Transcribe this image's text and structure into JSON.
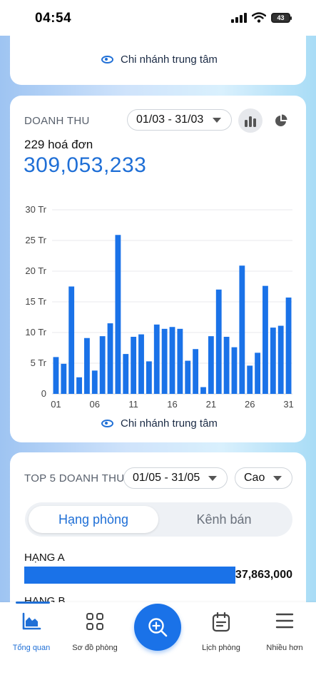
{
  "status_bar": {
    "time": "04:54",
    "battery": "43"
  },
  "branch_card": {
    "branch_label": "Chi nhánh trung tâm"
  },
  "revenue": {
    "title": "DOANH THU",
    "date_range": "01/03 - 31/03",
    "invoice_count": "229 hoá đơn",
    "total": "309,053,233",
    "branch_label": "Chi nhánh trung tâm"
  },
  "chart_data": {
    "type": "bar",
    "title": "",
    "xlabel": "",
    "ylabel": "",
    "ylim": [
      0,
      30
    ],
    "y_ticks": [
      "0",
      "5 Tr",
      "10 Tr",
      "15 Tr",
      "20 Tr",
      "25 Tr",
      "30 Tr"
    ],
    "x_tick_labels": [
      "01",
      "06",
      "11",
      "16",
      "21",
      "26",
      "31"
    ],
    "x_tick_days": [
      1,
      6,
      11,
      16,
      21,
      26,
      31
    ],
    "categories": [
      1,
      2,
      3,
      4,
      5,
      6,
      7,
      8,
      9,
      10,
      11,
      12,
      13,
      14,
      15,
      16,
      17,
      18,
      19,
      20,
      21,
      22,
      23,
      24,
      25,
      26,
      27,
      28,
      29,
      30,
      31
    ],
    "values": [
      6.0,
      4.9,
      17.5,
      2.7,
      9.1,
      3.8,
      9.4,
      11.5,
      25.9,
      6.5,
      9.3,
      9.7,
      5.3,
      11.3,
      10.6,
      10.9,
      10.6,
      5.4,
      7.3,
      1.1,
      9.4,
      17.0,
      9.3,
      7.6,
      20.9,
      4.6,
      6.7,
      17.6,
      10.8,
      11.1,
      15.7
    ],
    "unit": "Tr",
    "grid": true,
    "color": "#1a72e8"
  },
  "top5": {
    "title": "TOP 5 DOANH THU",
    "date_range": "01/05 - 31/05",
    "sort_value": "Cao",
    "tabs": [
      {
        "label": "Hạng phòng",
        "active": true
      },
      {
        "label": "Kênh bán",
        "active": false
      }
    ],
    "items": [
      {
        "name": "HẠNG A",
        "value": "37,863,000",
        "share": 0.79
      },
      {
        "name": "HẠNG B"
      }
    ]
  },
  "nav": {
    "items": [
      {
        "label": "Tổng quan",
        "icon": "area-chart-icon",
        "active": true
      },
      {
        "label": "Sơ đồ phòng",
        "icon": "grid-icon"
      },
      {
        "label": "Lịch phòng",
        "icon": "calendar-icon"
      },
      {
        "label": "Nhiều hơn",
        "icon": "menu-icon"
      }
    ],
    "fab_icon": "search-plus-icon"
  },
  "colors": {
    "accent": "#1f6fd6",
    "bar": "#1a72e8"
  }
}
